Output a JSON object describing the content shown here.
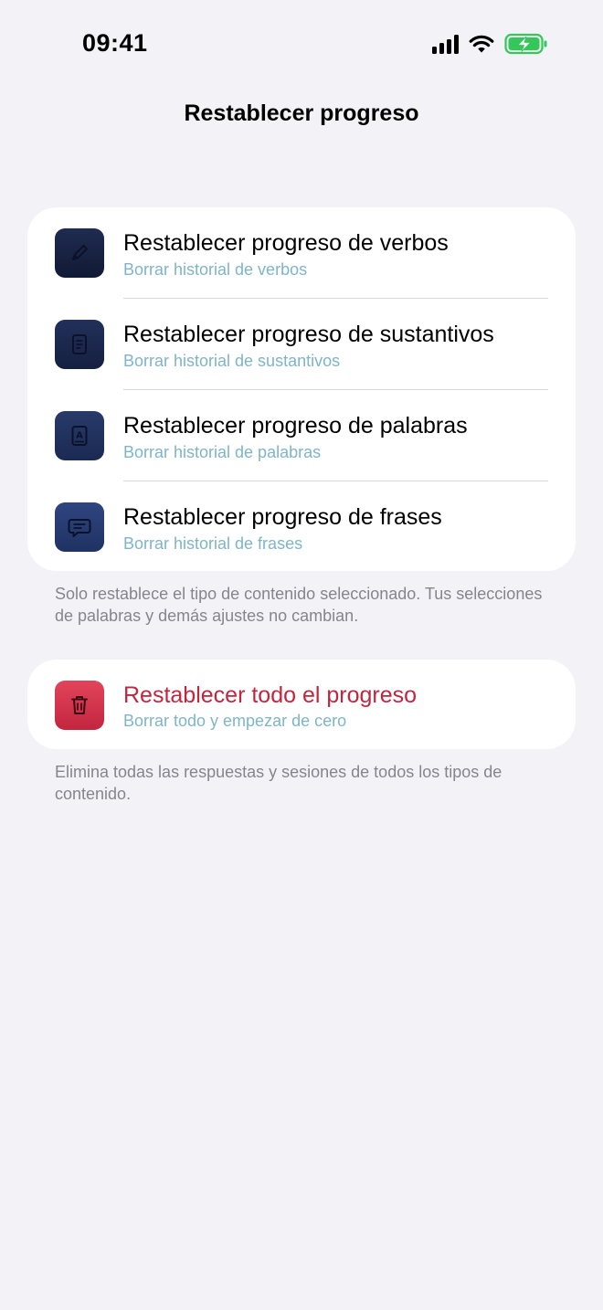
{
  "status_bar": {
    "time": "09:41",
    "icons": [
      "cellular-signal-icon",
      "wifi-icon",
      "battery-charging-icon"
    ]
  },
  "nav": {
    "title": "Restablecer progreso"
  },
  "reset_section": {
    "items": [
      {
        "icon": "pencil-icon",
        "title": "Restablecer progreso de verbos",
        "subtitle": "Borrar historial de verbos"
      },
      {
        "icon": "document-icon",
        "title": "Restablecer progreso de sustantivos",
        "subtitle": "Borrar historial de sustantivos"
      },
      {
        "icon": "dictionary-book-icon",
        "title": "Restablecer progreso de palabras",
        "subtitle": "Borrar historial de palabras"
      },
      {
        "icon": "speech-bubble-icon",
        "title": "Restablecer progreso de frases",
        "subtitle": "Borrar historial de frases"
      }
    ],
    "footnote": "Solo restablece el tipo de contenido seleccionado. Tus selecciones de palabras y demás ajustes no cambian."
  },
  "reset_all_section": {
    "icon": "trash-icon",
    "title": "Restablecer todo el progreso",
    "subtitle": "Borrar todo y empezar de cero",
    "footnote": "Elimina todas las respuestas y sesiones de todos los tipos de contenido."
  },
  "colors": {
    "background": "#F2F2F7",
    "card": "#FFFFFF",
    "subtitle": "#7FB5C7",
    "danger": "#C2263E",
    "icon_navy": "#1E2D57",
    "battery_green": "#34C759"
  }
}
